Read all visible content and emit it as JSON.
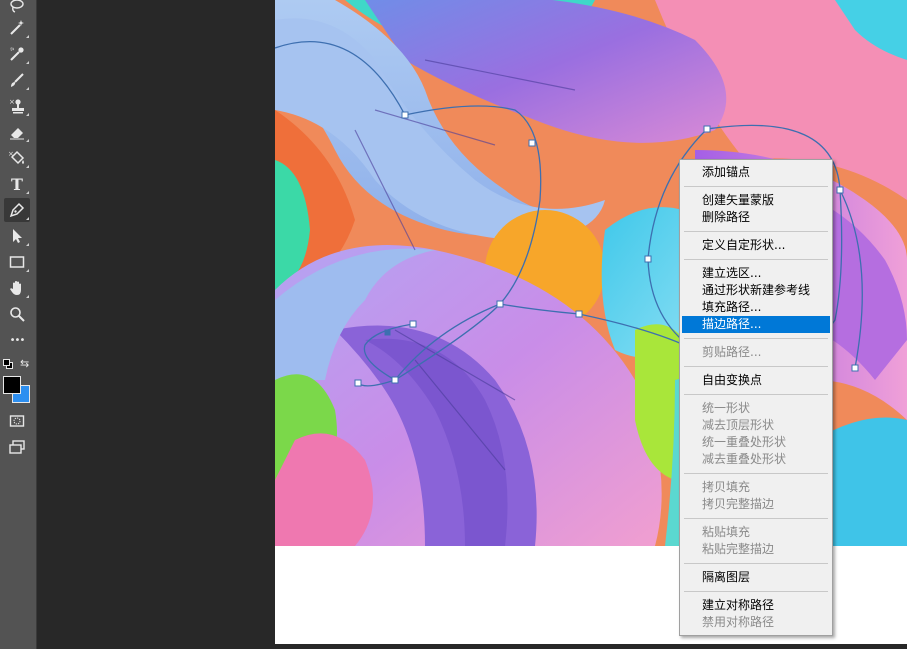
{
  "toolbar": {
    "tools": [
      {
        "name": "lasso-tool",
        "icon": "lasso-icon"
      },
      {
        "name": "magic-wand-tool",
        "icon": "magic-wand-icon"
      },
      {
        "name": "eyedropper-tool",
        "icon": "eyedropper-icon"
      },
      {
        "name": "brush-tool",
        "icon": "brush-icon"
      },
      {
        "name": "clone-stamp-tool",
        "icon": "clone-stamp-icon"
      },
      {
        "name": "eraser-tool",
        "icon": "eraser-icon"
      },
      {
        "name": "paint-bucket-tool",
        "icon": "paint-bucket-icon"
      },
      {
        "name": "type-tool",
        "icon": "type-icon",
        "label": "T"
      },
      {
        "name": "pen-tool",
        "icon": "pen-icon",
        "active": true
      },
      {
        "name": "path-selection-tool",
        "icon": "arrow-icon"
      },
      {
        "name": "rectangle-tool",
        "icon": "rectangle-icon"
      },
      {
        "name": "hand-tool",
        "icon": "hand-icon"
      },
      {
        "name": "zoom-tool",
        "icon": "zoom-icon"
      },
      {
        "name": "more-tools",
        "icon": "more-icon",
        "label": "•••"
      },
      {
        "name": "quick-mask",
        "icon": "quick-mask-icon"
      },
      {
        "name": "screen-mode",
        "icon": "screen-mode-icon"
      }
    ],
    "foreground_color": "#000000",
    "background_color": "#2d8ff0"
  },
  "context_menu": {
    "items": [
      {
        "label": "添加锚点",
        "enabled": true
      },
      {
        "label": "创建矢量蒙版",
        "enabled": true
      },
      {
        "label": "删除路径",
        "enabled": true
      },
      {
        "label": "定义自定形状...",
        "enabled": true
      },
      {
        "label": "建立选区...",
        "enabled": true
      },
      {
        "label": "通过形状新建参考线",
        "enabled": true
      },
      {
        "label": "填充路径...",
        "enabled": true
      },
      {
        "label": "描边路径...",
        "enabled": true,
        "highlighted": true
      },
      {
        "label": "剪贴路径...",
        "enabled": false
      },
      {
        "label": "自由变换点",
        "enabled": true
      },
      {
        "label": "统一形状",
        "enabled": false
      },
      {
        "label": "减去顶层形状",
        "enabled": false
      },
      {
        "label": "统一重叠处形状",
        "enabled": false
      },
      {
        "label": "减去重叠处形状",
        "enabled": false
      },
      {
        "label": "拷贝填充",
        "enabled": false
      },
      {
        "label": "拷贝完整描边",
        "enabled": false
      },
      {
        "label": "粘贴填充",
        "enabled": false
      },
      {
        "label": "粘贴完整描边",
        "enabled": false
      },
      {
        "label": "隔离图层",
        "enabled": true
      },
      {
        "label": "建立对称路径",
        "enabled": true
      },
      {
        "label": "禁用对称路径",
        "enabled": false
      }
    ]
  },
  "colors": {
    "highlight": "#0078d7",
    "path_stroke": "#3d6fb0",
    "menu_bg": "#f0f0f0"
  }
}
